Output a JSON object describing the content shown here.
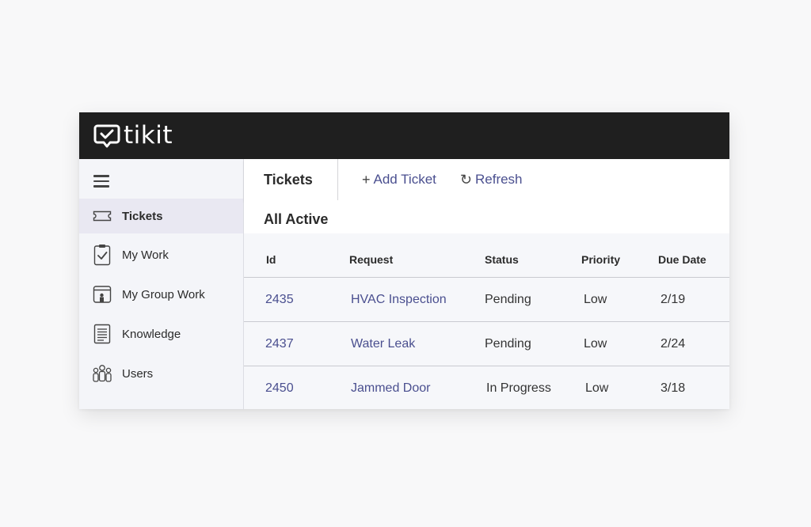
{
  "app": {
    "name": "tikit"
  },
  "sidebar": {
    "items": [
      {
        "label": "Tickets",
        "icon": "ticket-icon",
        "active": true
      },
      {
        "label": "My Work",
        "icon": "clipboard-check-icon"
      },
      {
        "label": "My Group Work",
        "icon": "group-work-icon"
      },
      {
        "label": "Knowledge",
        "icon": "document-icon"
      },
      {
        "label": "Users",
        "icon": "users-icon"
      }
    ]
  },
  "toolbar": {
    "title": "Tickets",
    "add_glyph": "+",
    "add_label": "Add Ticket",
    "refresh_glyph": "↻",
    "refresh_label": "Refresh"
  },
  "list": {
    "title": "All Active",
    "columns": [
      "Id",
      "Request",
      "Status",
      "Priority",
      "Due Date"
    ],
    "rows": [
      {
        "id": "2435",
        "request": "HVAC Inspection",
        "status": "Pending",
        "priority": "Low",
        "due": "2/19"
      },
      {
        "id": "2437",
        "request": "Water Leak",
        "status": "Pending",
        "priority": "Low",
        "due": "2/24"
      },
      {
        "id": "2450",
        "request": "Jammed Door",
        "status": "In Progress",
        "priority": "Low",
        "due": "3/18"
      }
    ]
  },
  "colors": {
    "topbar": "#1f1f1f",
    "accent": "#4a4f8f",
    "active_nav": "#e9e8f2"
  }
}
